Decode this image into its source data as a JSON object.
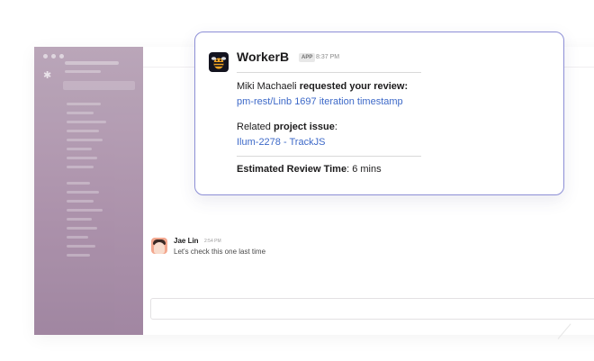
{
  "notification": {
    "bot_name": "WorkerB",
    "app_badge": "APP",
    "time": "8:37 PM",
    "review_requester": "Miki Machaeli",
    "review_phrase": "requested your review:",
    "review_link": "pm-rest/Linb 1697 iteration timestamp",
    "related_prefix": "Related",
    "related_bold": "project issue",
    "related_suffix": ":",
    "issue_link": "Ilum-2278 - TrackJS",
    "estimate_label": "Estimated Review Time",
    "estimate_value": ": 6 mins"
  },
  "message": {
    "author": "Jae Lin",
    "time": "2:54 PM",
    "text": "Let's check this one last time"
  },
  "colors": {
    "card_border": "#8d8fd6",
    "link": "#3d69c8",
    "sidebar": "#a98ea8",
    "bot_avatar_bg": "#13131f",
    "bot_avatar_accent": "#f5a623"
  },
  "icons": {
    "bot_avatar": "bee-icon",
    "workspace_logo": "slack-logo-icon"
  }
}
